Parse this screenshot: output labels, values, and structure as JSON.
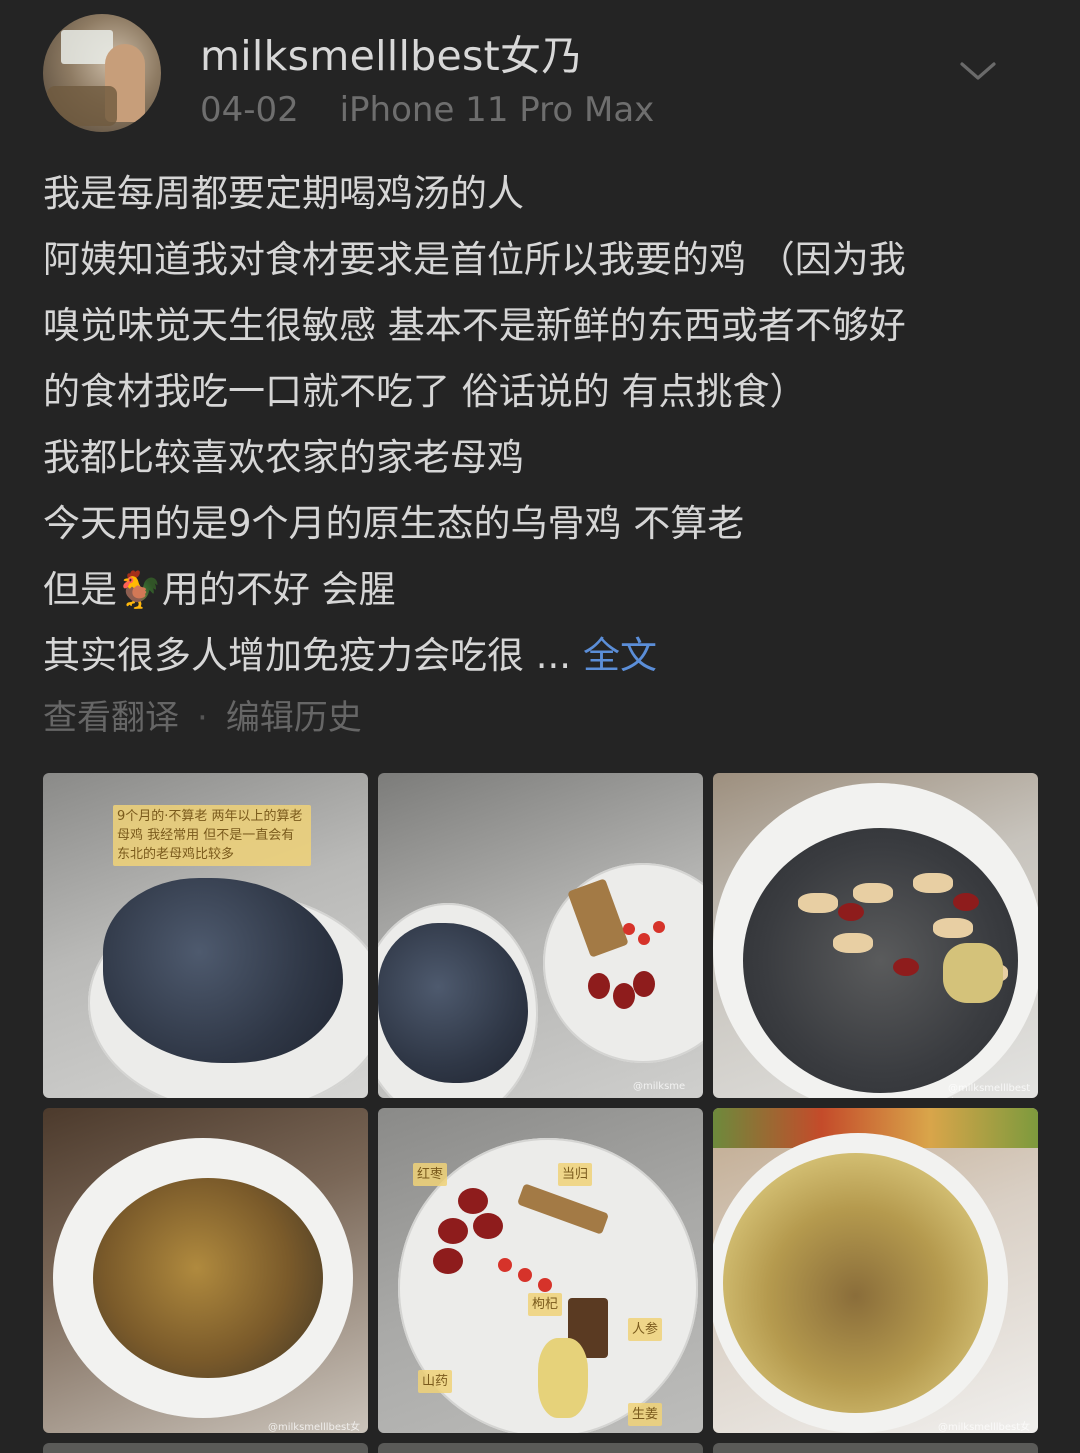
{
  "post": {
    "username": "milksmelllbest女乃",
    "date": "04-02",
    "device": "iPhone 11 Pro Max",
    "lines": [
      "我是每周都要定期喝鸡汤的人",
      "阿姨知道我对食材要求是首位所以我要的鸡 （因为我",
      "嗅觉味觉天生很敏感 基本不是新鲜的东西或者不够好",
      "的食材我吃一口就不吃了 俗话说的 有点挑食）",
      "我都比较喜欢农家的家老母鸡",
      "今天用的是9个月的原生态的乌骨鸡 不算老"
    ],
    "line_emoji_prefix": "但是",
    "line_emoji_suffix": "用的不好 会腥",
    "emoji": "🐓",
    "truncated_line": "其实很多人增加免疫力会吃很 ...",
    "full_text_link": "全文",
    "action_translate": "查看翻译",
    "action_separator": "·",
    "action_edit_history": "编辑历史"
  },
  "photos": {
    "photo1_caption": "9个月的·不算老 两年以上的算老母鸡 我经常用 但不是一直会有 东北的老母鸡比较多",
    "watermark_short": "@milksme",
    "watermark_full": "@milksmelllbest女乃",
    "labels": {
      "red_dates": "红枣",
      "angelica": "当归",
      "goji": "枸杞",
      "ginseng": "人参",
      "yam": "山药",
      "third": "生姜"
    }
  },
  "colors": {
    "background": "#242424",
    "link": "#5b8ed8",
    "primary_text": "#d6d6d6",
    "secondary_text": "#6e6e6e"
  },
  "icons": {
    "expand": "chevron-down-icon"
  }
}
